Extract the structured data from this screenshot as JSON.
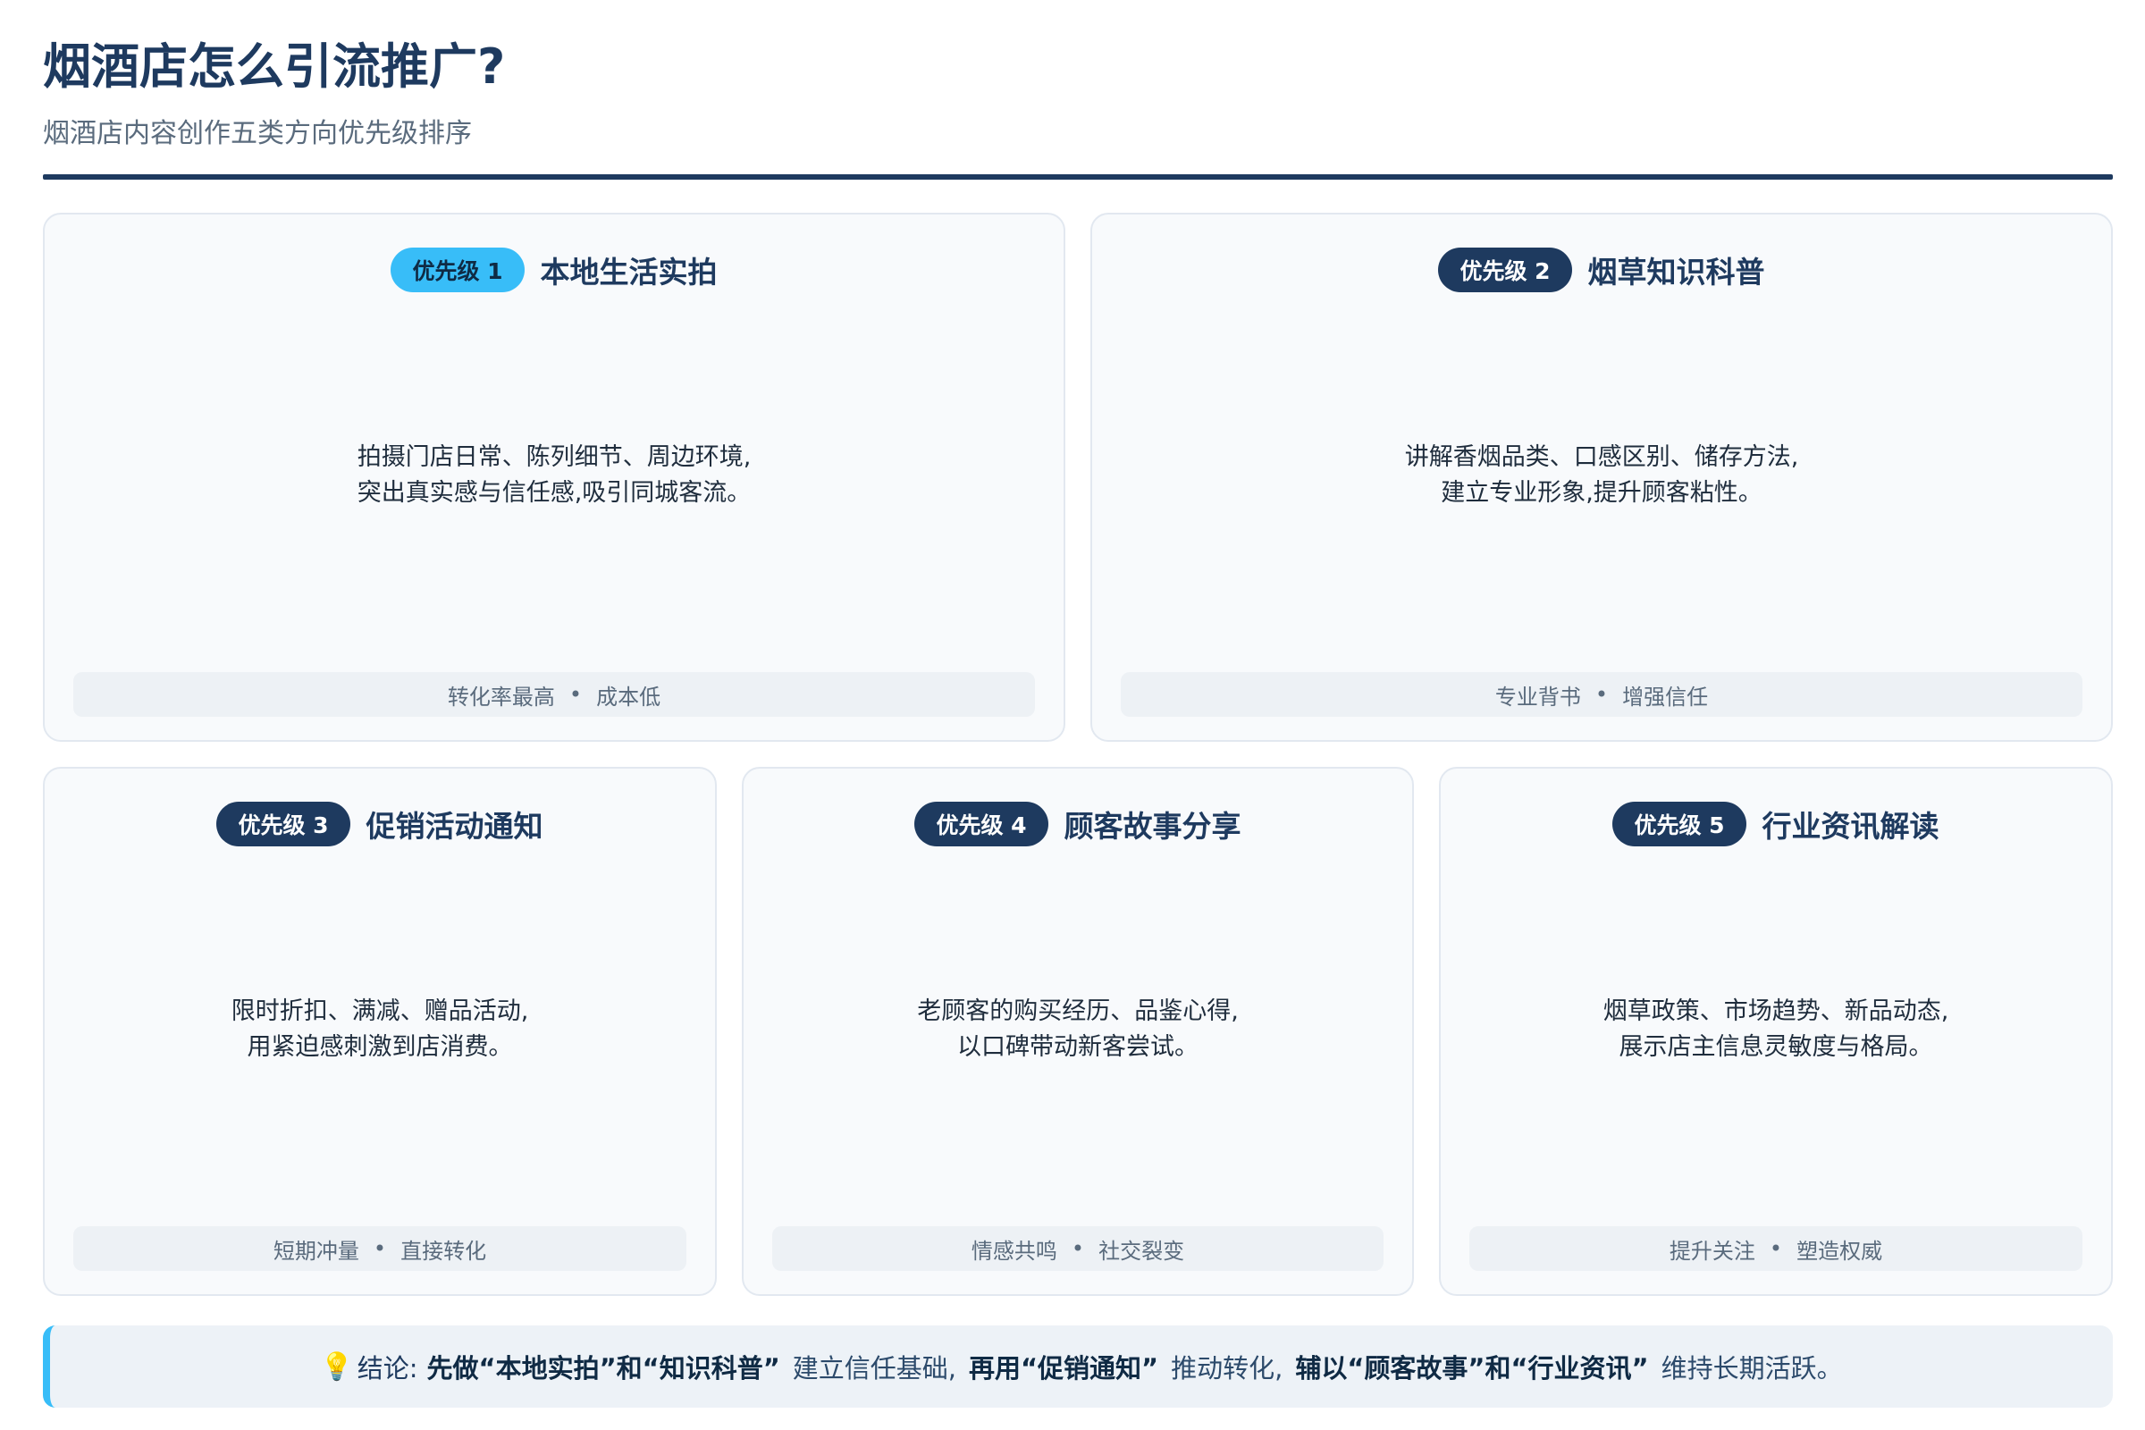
{
  "header": {
    "title": "烟酒店怎么引流推广?",
    "subtitle": "烟酒店内容创作五类方向优先级排序"
  },
  "cards": [
    {
      "badge": "优先级 1",
      "title": "本地生活实拍",
      "body_lines": [
        "拍摄门店日常、陈列细节、周边环境,",
        "突出真实感与信任感,吸引同城客流。"
      ],
      "tags": [
        "转化率最高",
        "成本低"
      ]
    },
    {
      "badge": "优先级 2",
      "title": "烟草知识科普",
      "body_lines": [
        "讲解香烟品类、口感区别、储存方法,",
        "建立专业形象,提升顾客粘性。"
      ],
      "tags": [
        "专业背书",
        "增强信任"
      ]
    },
    {
      "badge": "优先级 3",
      "title": "促销活动通知",
      "body_lines": [
        "限时折扣、满减、赠品活动,",
        "用紧迫感刺激到店消费。"
      ],
      "tags": [
        "短期冲量",
        "直接转化"
      ]
    },
    {
      "badge": "优先级 4",
      "title": "顾客故事分享",
      "body_lines": [
        "老顾客的购买经历、品鉴心得,",
        "以口碑带动新客尝试。"
      ],
      "tags": [
        "情感共鸣",
        "社交裂变"
      ]
    },
    {
      "badge": "优先级 5",
      "title": "行业资讯解读",
      "body_lines": [
        "烟草政策、市场趋势、新品动态,",
        "展示店主信息灵敏度与格局。"
      ],
      "tags": [
        "提升关注",
        "塑造权威"
      ]
    }
  ],
  "tag_separator": "•",
  "conclusion": {
    "icon": "lightbulb-icon",
    "bulb_glyph": "💡",
    "label": "结论:",
    "part1_bold": "先做“本地实拍”和“知识科普”",
    "part1_text": "建立信任基础,",
    "part2_bold": "再用“促销通知”",
    "part2_text": "推动转化,",
    "part3_bold": "辅以“顾客故事”和“行业资讯”",
    "part3_text": "维持长期活跃。"
  },
  "colors": {
    "primary": "#1e3a5f",
    "accent": "#38bdf8",
    "card_bg": "#f8fafc",
    "tag_bg": "#edf1f5"
  }
}
